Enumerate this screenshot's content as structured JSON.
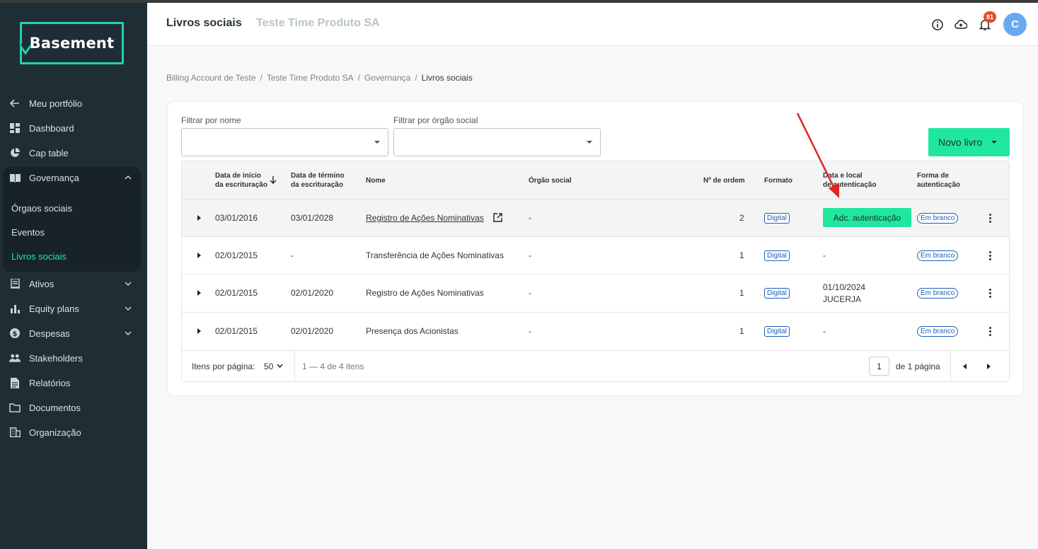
{
  "sidebar": {
    "logo": "Basement",
    "items": [
      {
        "label": "Meu portfólio",
        "icon": "arrow-left-icon"
      },
      {
        "label": "Dashboard",
        "icon": "dashboard-icon"
      },
      {
        "label": "Cap table",
        "icon": "pie-chart-icon"
      },
      {
        "label": "Governança",
        "icon": "book-icon"
      },
      {
        "label": "Ativos",
        "icon": "ledger-icon"
      },
      {
        "label": "Equity plans",
        "icon": "bar-chart-icon"
      },
      {
        "label": "Despesas",
        "icon": "dollar-icon"
      },
      {
        "label": "Stakeholders",
        "icon": "people-icon"
      },
      {
        "label": "Relatórios",
        "icon": "report-icon"
      },
      {
        "label": "Documentos",
        "icon": "folder-icon"
      },
      {
        "label": "Organização",
        "icon": "building-icon"
      }
    ],
    "gov_sub": [
      "Órgaos sociais",
      "Eventos",
      "Livros sociais"
    ]
  },
  "header": {
    "title": "Livros sociais",
    "company": "Teste Time Produto SA",
    "notifications": "81",
    "avatar": "C"
  },
  "breadcrumb": [
    "Billing Account de Teste",
    "Teste Time Produto SA",
    "Governança",
    "Livros sociais"
  ],
  "filters": {
    "name_label": "Filtrar por nome",
    "org_label": "Filtrar por órgão social",
    "new_button": "Novo livro"
  },
  "table": {
    "headers": {
      "start1": "Data de início",
      "start2": "da escrituração",
      "end1": "Data de término",
      "end2": "da escrituração",
      "name": "Nome",
      "org": "Órgão social",
      "order": "Nº de ordem",
      "format": "Formato",
      "auth1": "Data e local",
      "auth2": "de autenticação",
      "form1": "Forma de",
      "form2": "autenticação"
    },
    "rows": [
      {
        "start": "03/01/2016",
        "end": "03/01/2028",
        "name": "Registro de Ações Nominativas",
        "org": "-",
        "order": "2",
        "format": "Digital",
        "auth_button": "Adc. autenticação",
        "form": "Em branco"
      },
      {
        "start": "02/01/2015",
        "end": "-",
        "name": "Transferência de Ações Nominativas",
        "org": "-",
        "order": "1",
        "format": "Digital",
        "auth": "-",
        "form": "Em branco"
      },
      {
        "start": "02/01/2015",
        "end": "02/01/2020",
        "name": "Registro de Ações Nominativas",
        "org": "-",
        "order": "1",
        "format": "Digital",
        "auth": "01/10/2024",
        "auth2": "JUCERJA",
        "form": "Em branco"
      },
      {
        "start": "02/01/2015",
        "end": "02/01/2020",
        "name": "Presença dos Acionistas",
        "org": "-",
        "order": "1",
        "format": "Digital",
        "auth": "-",
        "form": "Em branco"
      }
    ],
    "footer": {
      "per_page_label": "Itens por página:",
      "per_page": "50",
      "range": "1 — 4 de 4 itens",
      "page": "1",
      "of_pages": "de 1 página"
    }
  },
  "colors": {
    "accent": "#1fe89e",
    "sidebar": "#1f2e35",
    "annotation": "#e02424"
  }
}
